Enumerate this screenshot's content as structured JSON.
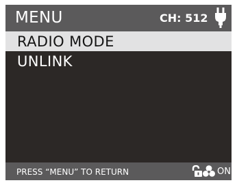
{
  "header": {
    "title": "MENU",
    "channel": "CH: 512",
    "power_icon": "plug-icon"
  },
  "menu": {
    "items": [
      {
        "label": "RADIO MODE",
        "selected": true
      },
      {
        "label": "UNLINK",
        "selected": false
      }
    ]
  },
  "footer": {
    "hint": "PRESS “MENU” TO RETURN",
    "lock_icon": "unlock-icon",
    "fan_icon": "fan-icon",
    "fan_state": "ON"
  },
  "colors": {
    "screen_bg": "#2c2826",
    "bar_bg": "#5b5a5b",
    "selection_bg": "#e2e2e3",
    "text": "#ffffff"
  }
}
